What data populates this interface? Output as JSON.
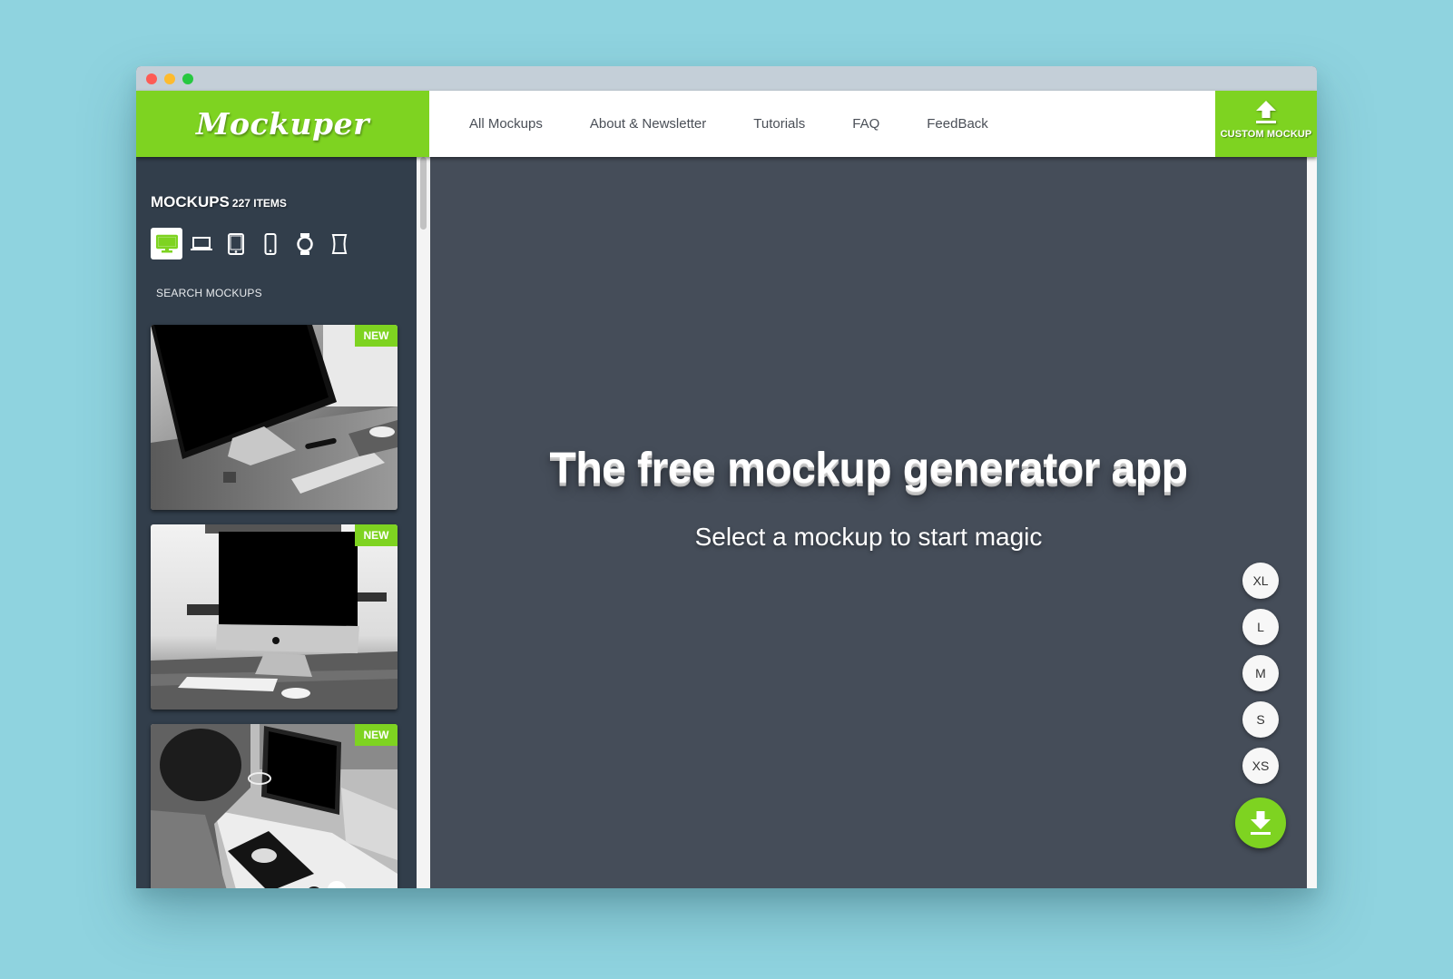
{
  "window": {
    "controls": [
      "close",
      "minimize",
      "maximize"
    ]
  },
  "header": {
    "logo": "Mockuper",
    "nav": [
      "All Mockups",
      "About & Newsletter",
      "Tutorials",
      "FAQ",
      "FeedBack"
    ],
    "custom_mockup": {
      "label": "CUSTOM MOCKUP",
      "icon": "upload-icon"
    }
  },
  "sidebar": {
    "title": "MOCKUPS",
    "count": "227 ITEMS",
    "device_filters": [
      {
        "name": "desktop",
        "icon": "desktop-icon",
        "active": true
      },
      {
        "name": "laptop",
        "icon": "laptop-icon",
        "active": false
      },
      {
        "name": "tablet",
        "icon": "tablet-icon",
        "active": false
      },
      {
        "name": "phone",
        "icon": "phone-icon",
        "active": false
      },
      {
        "name": "watch",
        "icon": "watch-icon",
        "active": false
      },
      {
        "name": "other",
        "icon": "frame-icon",
        "active": false
      }
    ],
    "search_placeholder": "SEARCH MOCKUPS",
    "cards": [
      {
        "badge": "NEW",
        "subject": "Monitor on wooden desk with keyboard"
      },
      {
        "badge": "NEW",
        "subject": "iMac on desk with keyboard and mouse"
      },
      {
        "badge": "NEW",
        "subject": "Person working at desktop computer"
      }
    ]
  },
  "main": {
    "headline": "The free mockup generator app",
    "subline": "Select a mockup to start magic",
    "sizes": [
      "XL",
      "L",
      "M",
      "S",
      "XS"
    ],
    "download_icon": "download-icon"
  },
  "colors": {
    "brand_green": "#7ed321",
    "sidebar_bg": "#323e4b",
    "main_bg": "#454d59",
    "page_bg": "#8fd3df"
  }
}
